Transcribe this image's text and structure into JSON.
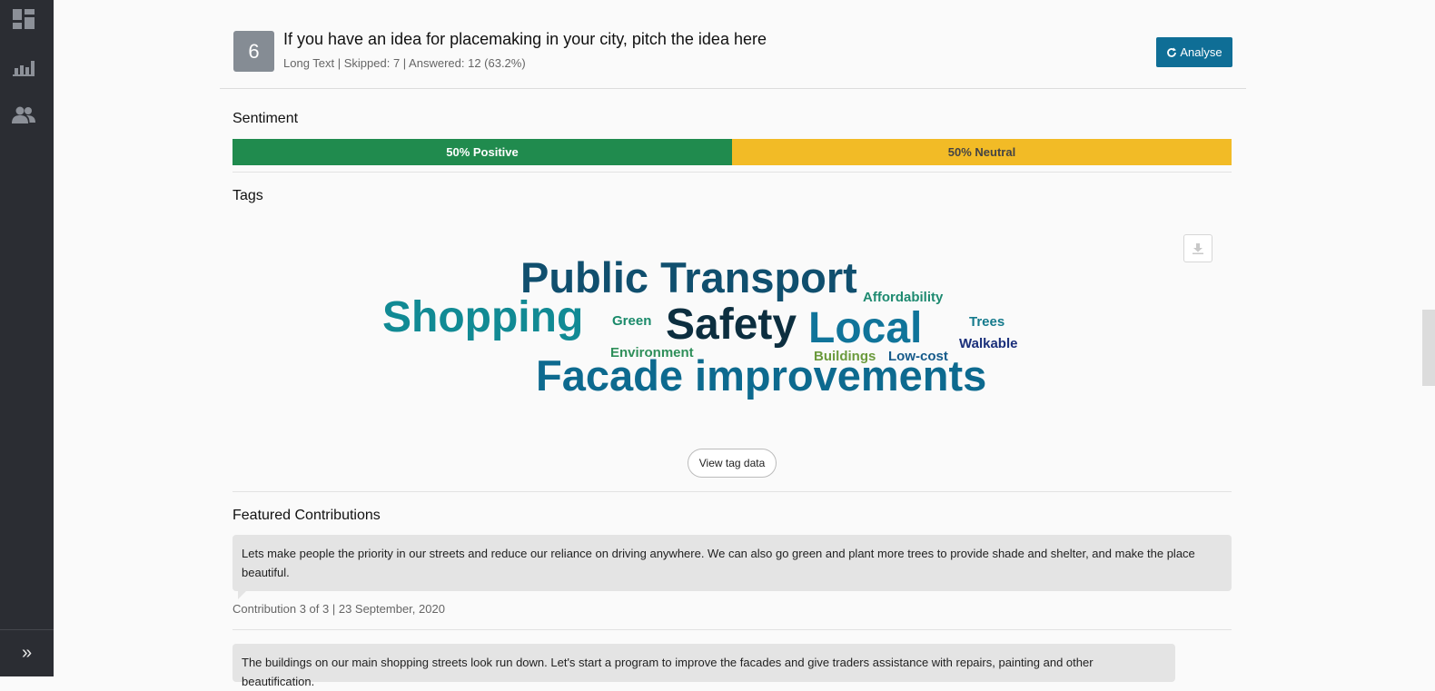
{
  "sidebar": {
    "icons": [
      "dashboard-icon",
      "bar-chart-icon",
      "users-icon"
    ],
    "expand_icon": "»"
  },
  "question": {
    "number": "6",
    "title": "If you have an idea for placemaking in your city, pitch the idea here",
    "meta": "Long Text | Skipped: 7 | Answered: 12 (63.2%)",
    "analyse_label": "Analyse"
  },
  "sentiment": {
    "title": "Sentiment",
    "positive_label": "50% Positive",
    "neutral_label": "50% Neutral",
    "positive_fraction": 0.5,
    "neutral_fraction": 0.5,
    "positive_color": "#208b4e",
    "neutral_color": "#f2bb26"
  },
  "tags": {
    "title": "Tags",
    "view_button": "View tag data",
    "words": [
      {
        "text": "Public Transport",
        "color": "#104f6e"
      },
      {
        "text": "Shopping",
        "color": "#118a94"
      },
      {
        "text": "Safety",
        "color": "#0c2e3f"
      },
      {
        "text": "Local",
        "color": "#10749a"
      },
      {
        "text": "Facade improvements",
        "color": "#0d6a8f"
      },
      {
        "text": "Affordability",
        "color": "#1e8a70"
      },
      {
        "text": "Green",
        "color": "#1a8a6a"
      },
      {
        "text": "Trees",
        "color": "#157a8c"
      },
      {
        "text": "Environment",
        "color": "#2f8f5a"
      },
      {
        "text": "Buildings",
        "color": "#6b9a3c"
      },
      {
        "text": "Low-cost",
        "color": "#155a8a"
      },
      {
        "text": "Walkable",
        "color": "#1a2f7a"
      }
    ]
  },
  "featured": {
    "title": "Featured Contributions",
    "items": [
      {
        "text": "Lets make people the priority in our streets and reduce our reliance on driving anywhere. We can also go green and plant more trees to provide shade and shelter, and make the place beautiful."
      },
      {
        "text": "The buildings on our main shopping streets look run down. Let's start a program to improve the facades and give traders assistance with repairs, painting and other beautification."
      }
    ],
    "meta": "Contribution 3 of 3 | 23 September, 2020"
  }
}
